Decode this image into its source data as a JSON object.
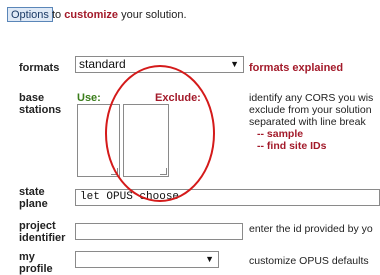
{
  "header": {
    "options_button": "Options",
    "intro_prefix": "to ",
    "intro_highlight": "customize",
    "intro_suffix": " your solution."
  },
  "formats": {
    "label": "formats",
    "selected": "standard",
    "link": "formats explained"
  },
  "base_stations": {
    "label_line1": "base",
    "label_line2": "stations",
    "use_label": "Use:",
    "exclude_label": "Exclude:",
    "help_line1": "identify any CORS you wis",
    "help_line2": "exclude from your solution",
    "help_line3": "separated with line break",
    "sample_link": "-- sample",
    "find_ids_link": "-- find site IDs"
  },
  "state_plane": {
    "label_line1": "state",
    "label_line2": "plane",
    "value": "let OPUS choose"
  },
  "project_identifier": {
    "label_line1": "project",
    "label_line2": "identifier",
    "value": "",
    "help": "enter the id provided by yo"
  },
  "my_profile": {
    "label_line1": "my",
    "label_line2": "profile",
    "selected": "",
    "help": "customize OPUS defaults"
  },
  "colors": {
    "accent_red": "#a31a2a",
    "use_green": "#3a7d1a",
    "annotation_circle": "#d41a1a"
  }
}
